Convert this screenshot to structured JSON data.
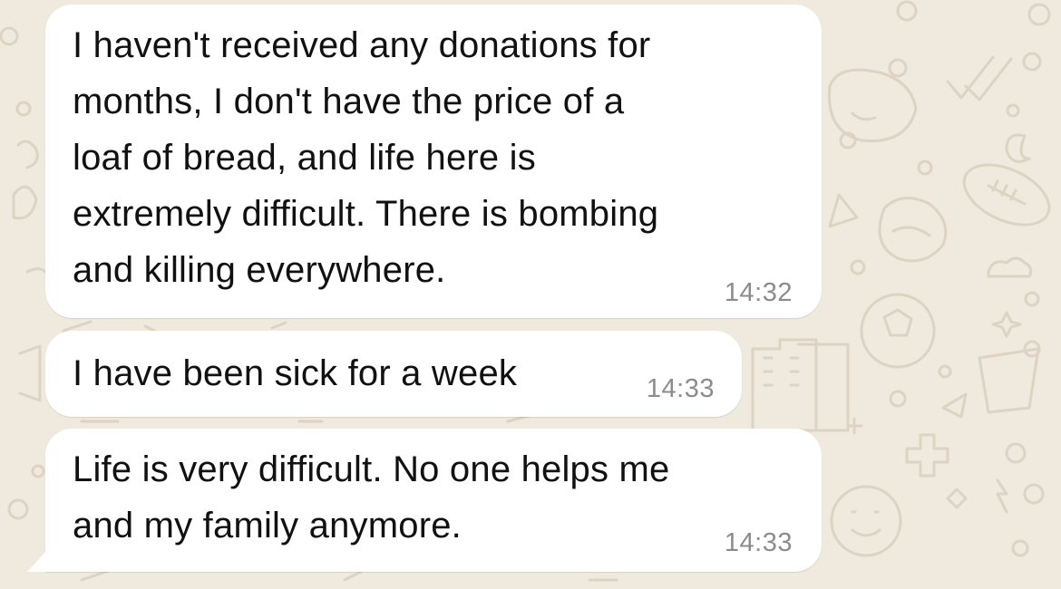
{
  "chat": {
    "background_color": "#efe9de",
    "bubble_color": "#ffffff",
    "messages": [
      {
        "text": "I haven't received any donations for\nmonths, I don't have the price of a\nloaf of bread, and life here is\nextremely difficult. There is bombing\nand killing everywhere.",
        "time": "14:32"
      },
      {
        "text": "I have been sick for a week",
        "time": "14:33"
      },
      {
        "text": "Life is very difficult. No one helps me\nand my family anymore.",
        "time": "14:33"
      }
    ]
  }
}
